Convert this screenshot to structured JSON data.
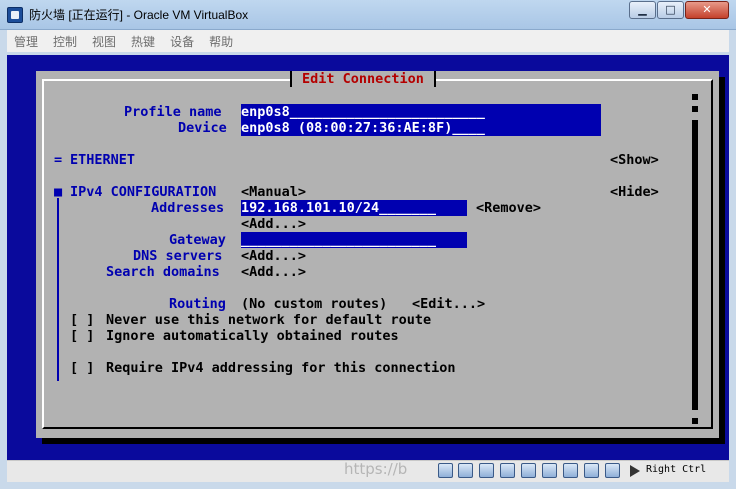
{
  "window": {
    "title": "防火墙 [正在运行] - Oracle VM VirtualBox",
    "minimize": "▁",
    "maximize": "□",
    "close": "✕"
  },
  "menu": [
    "管理",
    "控制",
    "视图",
    "热键",
    "设备",
    "帮助"
  ],
  "dialog": {
    "title": "Edit Connection",
    "profile_name_label": "Profile name",
    "profile_name_value": "enp0s8________________________",
    "device_label": "Device",
    "device_value": "enp0s8 (08:00:27:36:AE:8F)____",
    "ethernet_marker": "=",
    "ethernet_label": "ETHERNET",
    "ethernet_action": "<Show>",
    "ipv4_marker": "■",
    "ipv4_label": "IPv4 CONFIGURATION",
    "ipv4_mode": "<Manual>",
    "ipv4_action": "<Hide>",
    "addresses_label": "Addresses",
    "addresses_value": "192.168.101.10/24_______",
    "remove_button": "<Remove>",
    "add_address_button": "<Add...>",
    "gateway_label": "Gateway",
    "gateway_value": "________________________",
    "dns_label": "DNS servers",
    "dns_add_button": "<Add...>",
    "search_label": "Search domains",
    "search_add_button": "<Add...>",
    "routing_label": "Routing",
    "routing_value": "(No custom routes)",
    "routing_edit_button": "<Edit...>",
    "never_default_check": "[ ]",
    "never_default_label": "Never use this network for default route",
    "ignore_auto_check": "[ ]",
    "ignore_auto_label": "Ignore automatically obtained routes",
    "require_ipv4_check": "[ ]",
    "require_ipv4_label": "Require IPv4 addressing for this connection",
    "scroll_up": "▪",
    "scroll_down": "▪"
  },
  "statusbar": {
    "host_key": "Right Ctrl",
    "watermark": "https://b"
  },
  "colors": {
    "console_bg": "#0a0a9c",
    "dialog_bg": "#b2b2b2",
    "label": "#0000b0",
    "title": "#b40000"
  }
}
